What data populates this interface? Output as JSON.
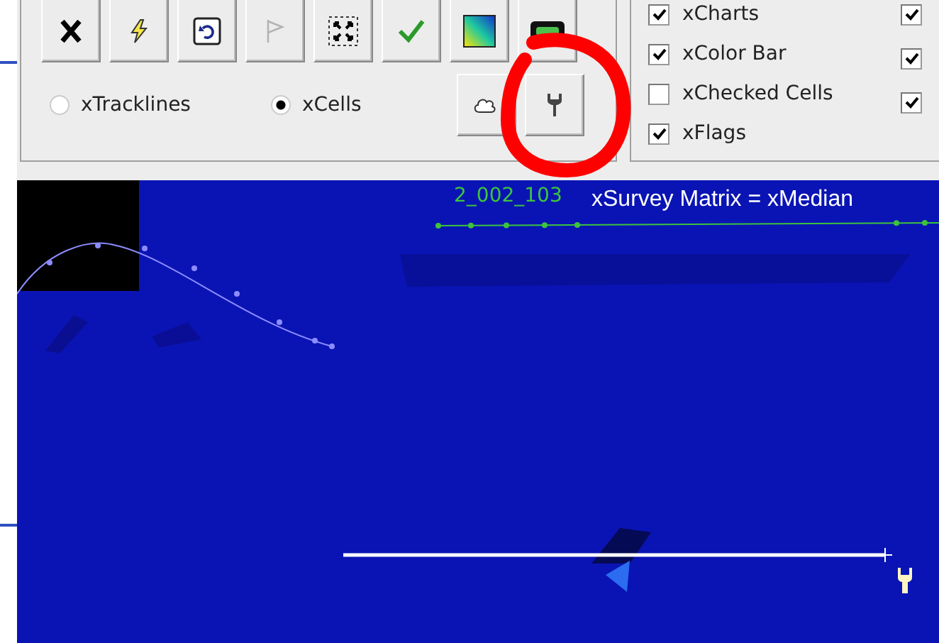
{
  "toolbar": {
    "buttons": [
      {
        "kind": "cross",
        "disabled": false
      },
      {
        "kind": "lightning",
        "disabled": false
      },
      {
        "kind": "undo",
        "disabled": false
      },
      {
        "kind": "flag",
        "disabled": true
      },
      {
        "kind": "fit",
        "disabled": false
      },
      {
        "kind": "check",
        "disabled": false
      },
      {
        "kind": "gradient",
        "disabled": false
      },
      {
        "kind": "bar",
        "disabled": false
      }
    ]
  },
  "display_mode": [
    {
      "label": "xTracklines",
      "selected": false
    },
    {
      "label": "xCells",
      "selected": true
    }
  ],
  "tool_buttons": [
    {
      "kind": "cloud"
    },
    {
      "kind": "wrench"
    }
  ],
  "layers": {
    "column_1": [
      {
        "label": "xCharts",
        "checked": true
      },
      {
        "label": "xColor Bar",
        "checked": true
      },
      {
        "label": "xChecked Cells",
        "checked": false
      },
      {
        "label": "xFlags",
        "checked": true
      }
    ],
    "column_2": [
      {
        "checked": true
      },
      {
        "checked": true
      },
      {
        "checked": true
      }
    ]
  },
  "map": {
    "track_label": "2_002_103",
    "title": "xSurvey Matrix = xMedian"
  }
}
